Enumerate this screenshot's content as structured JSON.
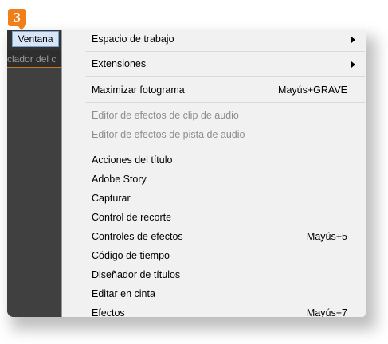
{
  "step_badge": "3",
  "menubar": {
    "active_menu": "Ventana"
  },
  "panel": {
    "tab_label": "clador del c"
  },
  "menu": {
    "items": [
      {
        "label": "Espacio de trabajo",
        "shortcut": "",
        "submenu": true,
        "enabled": true
      },
      {
        "label": "Extensiones",
        "shortcut": "",
        "submenu": true,
        "enabled": true
      },
      {
        "label": "Maximizar fotograma",
        "shortcut": "Mayús+GRAVE",
        "submenu": false,
        "enabled": true
      },
      {
        "label": "Editor de efectos de clip de audio",
        "shortcut": "",
        "submenu": false,
        "enabled": false
      },
      {
        "label": "Editor de efectos de pista de audio",
        "shortcut": "",
        "submenu": false,
        "enabled": false
      },
      {
        "label": "Acciones del título",
        "shortcut": "",
        "submenu": false,
        "enabled": true
      },
      {
        "label": "Adobe Story",
        "shortcut": "",
        "submenu": false,
        "enabled": true
      },
      {
        "label": "Capturar",
        "shortcut": "",
        "submenu": false,
        "enabled": true
      },
      {
        "label": "Control de recorte",
        "shortcut": "",
        "submenu": false,
        "enabled": true
      },
      {
        "label": "Controles de efectos",
        "shortcut": "Mayús+5",
        "submenu": false,
        "enabled": true
      },
      {
        "label": "Código de tiempo",
        "shortcut": "",
        "submenu": false,
        "enabled": true
      },
      {
        "label": "Diseñador de títulos",
        "shortcut": "",
        "submenu": false,
        "enabled": true
      },
      {
        "label": "Editar en cinta",
        "shortcut": "",
        "submenu": false,
        "enabled": true
      },
      {
        "label": "Efectos",
        "shortcut": "Mayús+7",
        "submenu": false,
        "enabled": true
      }
    ]
  },
  "colors": {
    "badge": "#f07f1a",
    "menu_bg": "#f1f1f1",
    "disabled_text": "#8d8d8d",
    "app_bg": "#404040",
    "accent_line": "#c8781f"
  }
}
